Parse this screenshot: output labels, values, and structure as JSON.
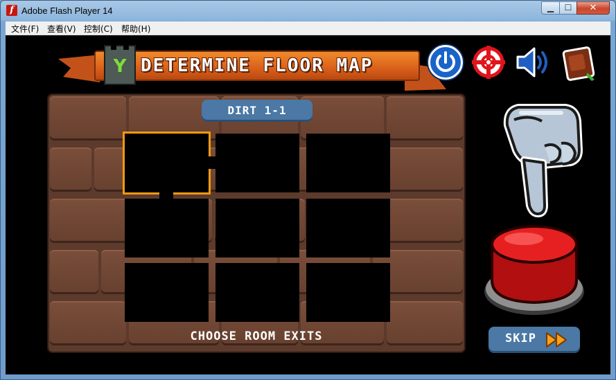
{
  "window": {
    "title": "Adobe Flash Player 14",
    "app_icon_letter": "f",
    "controls": {
      "minimize": "▁",
      "maximize": "☐",
      "close": "✕"
    }
  },
  "menu": [
    {
      "label": "文件(F)"
    },
    {
      "label": "查看(V)"
    },
    {
      "label": "控制(C)"
    },
    {
      "label": "帮助(H)"
    }
  ],
  "game": {
    "banner_title": "DETERMINE FLOOR MAP",
    "level_label": "DIRT 1-1",
    "instruction": "CHOOSE ROOM EXITS",
    "skip_label": "SKIP",
    "selected_room": {
      "row": 0,
      "col": 0
    },
    "top_icons": [
      "power-icon",
      "crosshair-icon",
      "speaker-icon",
      "spellbook-icon"
    ],
    "colors": {
      "selection": "#f29a12",
      "pill": "#4b78a4",
      "banner": "#e0701f",
      "button_red": "#e01a1a",
      "power_blue": "#1a63c9"
    }
  }
}
